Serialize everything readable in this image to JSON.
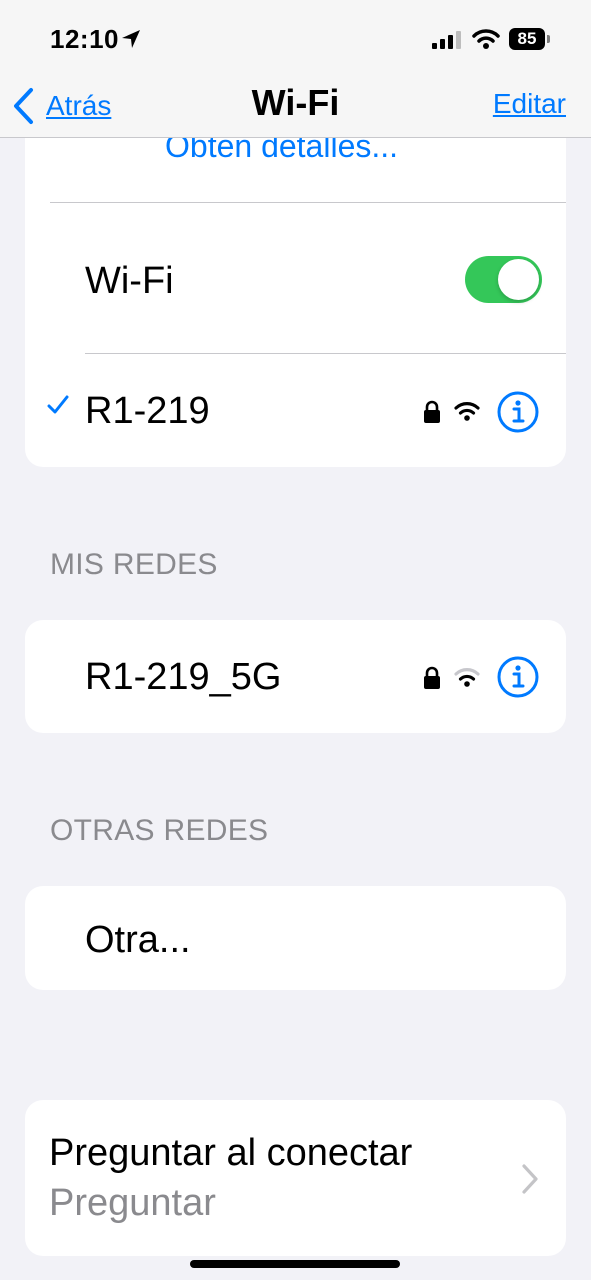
{
  "status_bar": {
    "time": "12:10",
    "battery": "85",
    "icons": [
      "location-arrow-icon",
      "cellular-signal-icon",
      "wifi-status-icon",
      "battery-icon"
    ]
  },
  "nav": {
    "back_label": "Atrás",
    "title": "Wi-Fi",
    "edit_label": "Editar"
  },
  "top_card": {
    "details_link": "Obtén detalles...",
    "wifi_label": "Wi-Fi",
    "wifi_enabled": true,
    "connected_network": {
      "name": "R1-219",
      "secured": true,
      "signal_level": "full"
    }
  },
  "my_networks": {
    "header": "MIS REDES",
    "items": [
      {
        "name": "R1-219_5G",
        "secured": true,
        "signal_level": "weak"
      }
    ]
  },
  "other_networks": {
    "header": "OTRAS REDES",
    "other_label": "Otra..."
  },
  "ask_to_join": {
    "title": "Preguntar al conectar",
    "value": "Preguntar"
  },
  "colors": {
    "accent": "#007aff",
    "toggle_on": "#34c759",
    "background": "#f2f2f7",
    "secondary_text": "#8a8a8e"
  }
}
